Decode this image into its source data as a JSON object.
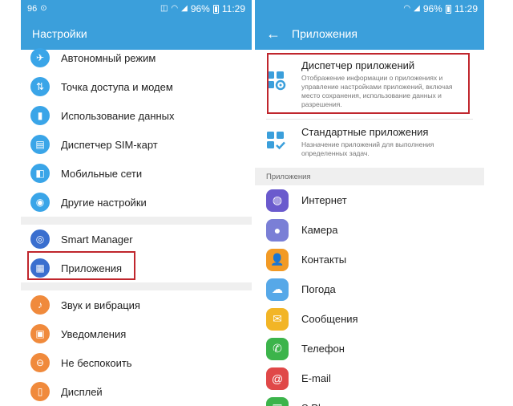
{
  "left": {
    "status": {
      "left_text": "96",
      "battery": "96%",
      "time": "11:29"
    },
    "title": "Настройки",
    "items_top": [
      {
        "label": "Автономный режим",
        "icon": "airplane-icon",
        "glyph": "✈",
        "color": "#3aa5e8"
      },
      {
        "label": "Точка доступа и модем",
        "icon": "hotspot-icon",
        "glyph": "⇅",
        "color": "#3aa5e8"
      },
      {
        "label": "Использование данных",
        "icon": "data-usage-icon",
        "glyph": "▮",
        "color": "#3aa5e8"
      },
      {
        "label": "Диспетчер SIM-карт",
        "icon": "sim-card-icon",
        "glyph": "▤",
        "color": "#3aa5e8"
      },
      {
        "label": "Мобильные сети",
        "icon": "mobile-network-icon",
        "glyph": "◧",
        "color": "#3aa5e8"
      },
      {
        "label": "Другие настройки",
        "icon": "other-settings-icon",
        "glyph": "◉",
        "color": "#3aa5e8"
      }
    ],
    "items_mid": [
      {
        "label": "Smart Manager",
        "icon": "smart-manager-icon",
        "glyph": "◎",
        "color": "#3a6fcf"
      },
      {
        "label": "Приложения",
        "icon": "apps-grid-icon",
        "glyph": "▦",
        "color": "#3a6fcf"
      }
    ],
    "items_bottom": [
      {
        "label": "Звук и вибрация",
        "icon": "sound-icon",
        "glyph": "♪",
        "color": "#f08a3c"
      },
      {
        "label": "Уведомления",
        "icon": "notifications-icon",
        "glyph": "▣",
        "color": "#f08a3c"
      },
      {
        "label": "Не беспокоить",
        "icon": "do-not-disturb-icon",
        "glyph": "⊖",
        "color": "#f08a3c"
      },
      {
        "label": "Дисплей",
        "icon": "display-icon",
        "glyph": "▯",
        "color": "#f08a3c"
      }
    ]
  },
  "right": {
    "status": {
      "battery": "96%",
      "time": "11:29"
    },
    "title": "Приложения",
    "app_manager": {
      "title": "Диспетчер приложений",
      "desc": "Отображение информации о приложениях и управление настройками приложений, включая место сохранения, использование данных и разрешения."
    },
    "default_apps": {
      "title": "Стандартные приложения",
      "desc": "Назначение приложений для выполнения определенных задач."
    },
    "section_label": "Приложения",
    "apps": [
      {
        "label": "Интернет",
        "icon": "internet-icon",
        "glyph": "◍",
        "color": "#6a5acd"
      },
      {
        "label": "Камера",
        "icon": "camera-icon",
        "glyph": "●",
        "color": "#7a7fd6"
      },
      {
        "label": "Контакты",
        "icon": "contacts-icon",
        "glyph": "👤",
        "color": "#f29a25"
      },
      {
        "label": "Погода",
        "icon": "weather-icon",
        "glyph": "☁",
        "color": "#56a8e8"
      },
      {
        "label": "Сообщения",
        "icon": "messages-icon",
        "glyph": "✉",
        "color": "#f2b526"
      },
      {
        "label": "Телефон",
        "icon": "phone-icon",
        "glyph": "✆",
        "color": "#3cb44b"
      },
      {
        "label": "E-mail",
        "icon": "email-icon",
        "glyph": "@",
        "color": "#e04848"
      },
      {
        "label": "S Planner",
        "icon": "s-planner-icon",
        "glyph": "▦",
        "color": "#3cb44b"
      }
    ]
  },
  "colors": {
    "accent": "#3b9fdb",
    "highlight": "#c0262d"
  }
}
